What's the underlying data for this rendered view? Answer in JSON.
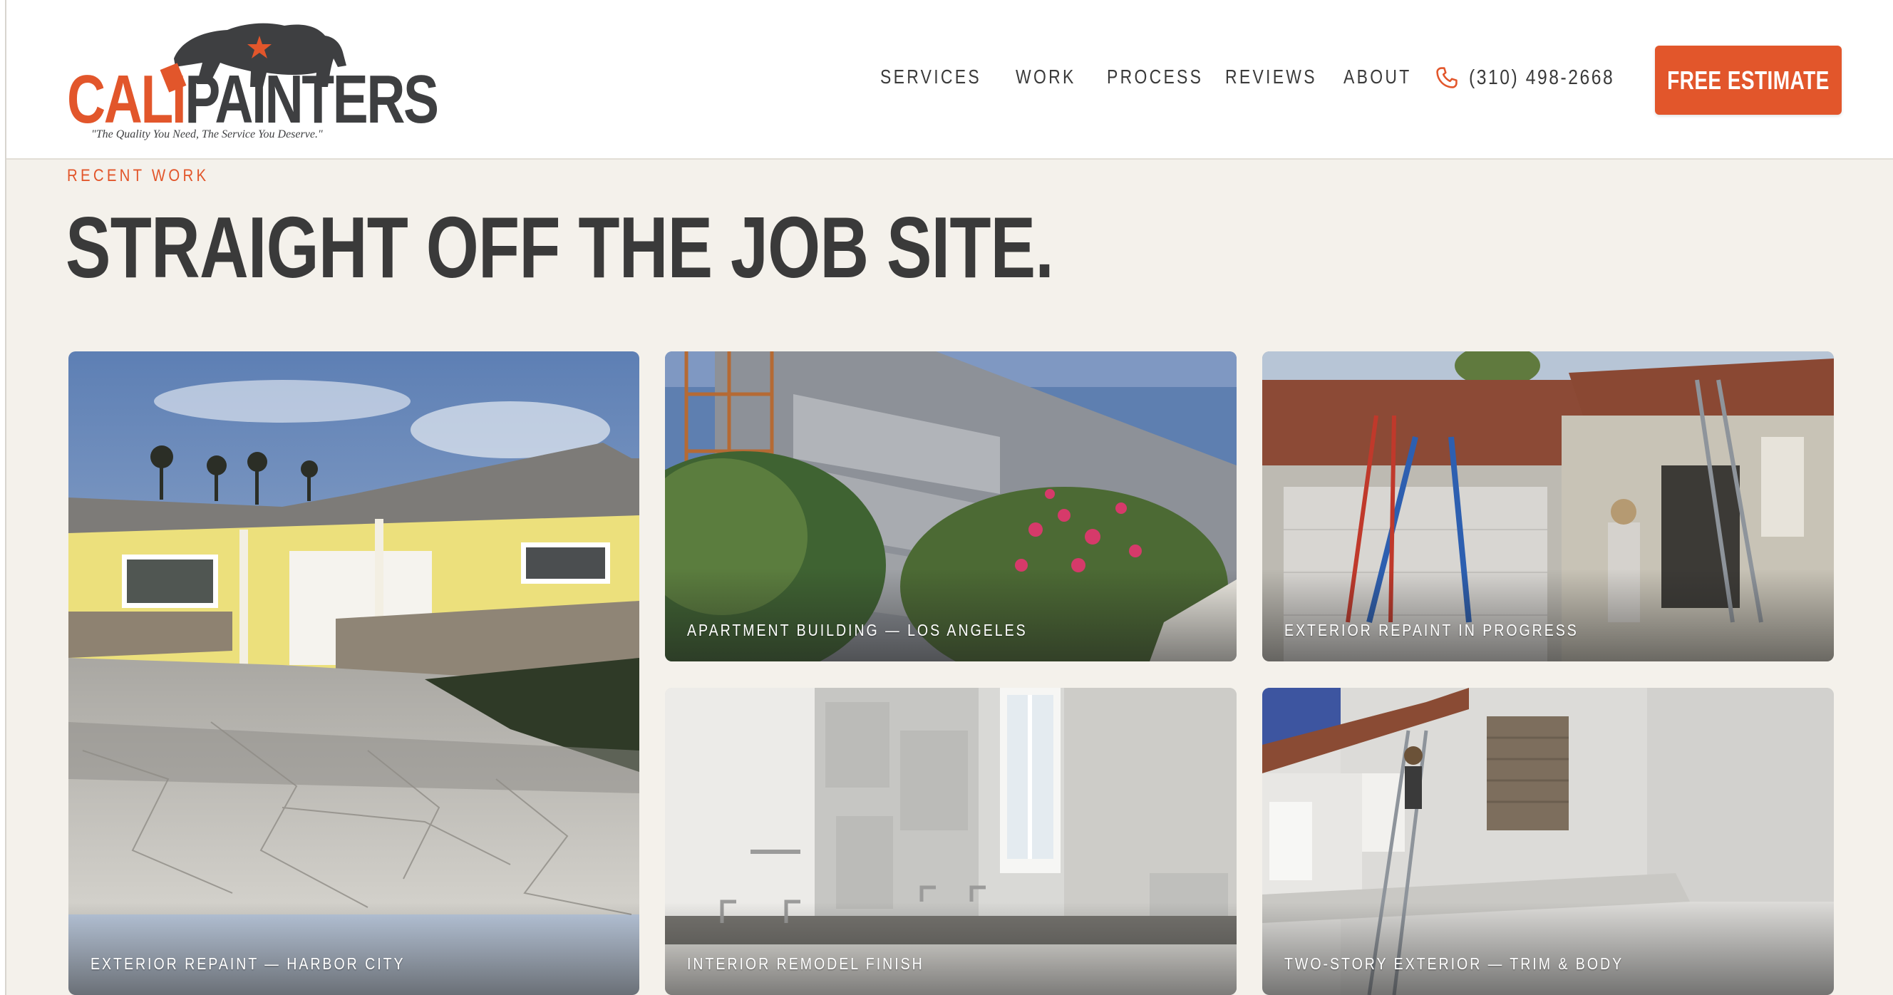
{
  "brand": {
    "name_part1": "CALI",
    "name_part2": "PAINTERS",
    "tagline": "\"The Quality You Need, The Service You Deserve.\"",
    "accent_color": "#e2562b",
    "dark_color": "#3e3f41"
  },
  "nav": {
    "items": [
      "SERVICES",
      "WORK",
      "PROCESS",
      "REVIEWS",
      "ABOUT"
    ],
    "phone": "(310) 498-2668",
    "phone_icon": "phone-icon",
    "cta_label": "FREE ESTIMATE"
  },
  "section": {
    "eyebrow": "RECENT WORK",
    "headline": "STRAIGHT OFF THE JOB SITE."
  },
  "gallery": [
    {
      "caption": "EXTERIOR REPAINT — HARBOR CITY"
    },
    {
      "caption": "APARTMENT BUILDING — LOS ANGELES"
    },
    {
      "caption": "EXTERIOR REPAINT IN PROGRESS"
    },
    {
      "caption": "INTERIOR REMODEL FINISH"
    },
    {
      "caption": "TWO-STORY EXTERIOR — TRIM & BODY"
    }
  ]
}
